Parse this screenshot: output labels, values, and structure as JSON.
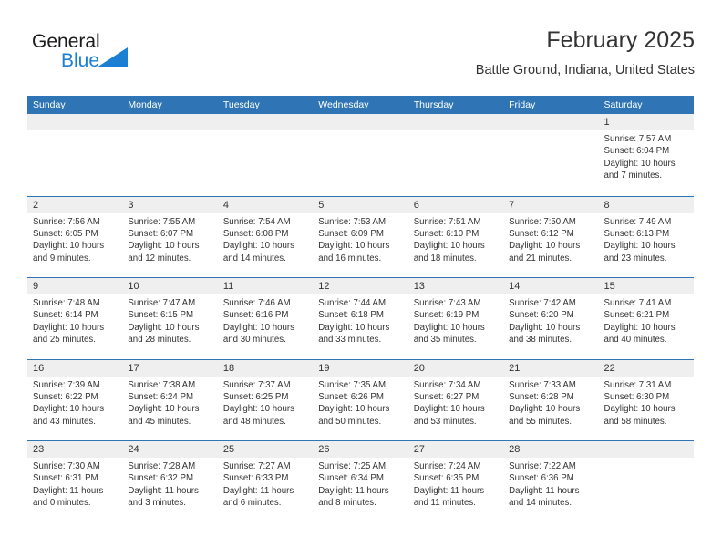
{
  "brand": {
    "name_part1": "General",
    "name_part2": "Blue",
    "triangle_color": "#1b7fd4",
    "text_color": "#1b1b1b"
  },
  "header": {
    "title": "February 2025",
    "subtitle": "Battle Ground, Indiana, United States"
  },
  "colors": {
    "header_blue": "#2f75b5",
    "daynum_band": "#efefef",
    "text": "#333333"
  },
  "weekdays": [
    "Sunday",
    "Monday",
    "Tuesday",
    "Wednesday",
    "Thursday",
    "Friday",
    "Saturday"
  ],
  "weeks": [
    [
      {
        "day": "",
        "sunrise": "",
        "sunset": "",
        "daylight": "",
        "empty": true
      },
      {
        "day": "",
        "sunrise": "",
        "sunset": "",
        "daylight": "",
        "empty": true
      },
      {
        "day": "",
        "sunrise": "",
        "sunset": "",
        "daylight": "",
        "empty": true
      },
      {
        "day": "",
        "sunrise": "",
        "sunset": "",
        "daylight": "",
        "empty": true
      },
      {
        "day": "",
        "sunrise": "",
        "sunset": "",
        "daylight": "",
        "empty": true
      },
      {
        "day": "",
        "sunrise": "",
        "sunset": "",
        "daylight": "",
        "empty": true
      },
      {
        "day": "1",
        "sunrise": "Sunrise: 7:57 AM",
        "sunset": "Sunset: 6:04 PM",
        "daylight": "Daylight: 10 hours and 7 minutes.",
        "empty": false
      }
    ],
    [
      {
        "day": "2",
        "sunrise": "Sunrise: 7:56 AM",
        "sunset": "Sunset: 6:05 PM",
        "daylight": "Daylight: 10 hours and 9 minutes.",
        "empty": false
      },
      {
        "day": "3",
        "sunrise": "Sunrise: 7:55 AM",
        "sunset": "Sunset: 6:07 PM",
        "daylight": "Daylight: 10 hours and 12 minutes.",
        "empty": false
      },
      {
        "day": "4",
        "sunrise": "Sunrise: 7:54 AM",
        "sunset": "Sunset: 6:08 PM",
        "daylight": "Daylight: 10 hours and 14 minutes.",
        "empty": false
      },
      {
        "day": "5",
        "sunrise": "Sunrise: 7:53 AM",
        "sunset": "Sunset: 6:09 PM",
        "daylight": "Daylight: 10 hours and 16 minutes.",
        "empty": false
      },
      {
        "day": "6",
        "sunrise": "Sunrise: 7:51 AM",
        "sunset": "Sunset: 6:10 PM",
        "daylight": "Daylight: 10 hours and 18 minutes.",
        "empty": false
      },
      {
        "day": "7",
        "sunrise": "Sunrise: 7:50 AM",
        "sunset": "Sunset: 6:12 PM",
        "daylight": "Daylight: 10 hours and 21 minutes.",
        "empty": false
      },
      {
        "day": "8",
        "sunrise": "Sunrise: 7:49 AM",
        "sunset": "Sunset: 6:13 PM",
        "daylight": "Daylight: 10 hours and 23 minutes.",
        "empty": false
      }
    ],
    [
      {
        "day": "9",
        "sunrise": "Sunrise: 7:48 AM",
        "sunset": "Sunset: 6:14 PM",
        "daylight": "Daylight: 10 hours and 25 minutes.",
        "empty": false
      },
      {
        "day": "10",
        "sunrise": "Sunrise: 7:47 AM",
        "sunset": "Sunset: 6:15 PM",
        "daylight": "Daylight: 10 hours and 28 minutes.",
        "empty": false
      },
      {
        "day": "11",
        "sunrise": "Sunrise: 7:46 AM",
        "sunset": "Sunset: 6:16 PM",
        "daylight": "Daylight: 10 hours and 30 minutes.",
        "empty": false
      },
      {
        "day": "12",
        "sunrise": "Sunrise: 7:44 AM",
        "sunset": "Sunset: 6:18 PM",
        "daylight": "Daylight: 10 hours and 33 minutes.",
        "empty": false
      },
      {
        "day": "13",
        "sunrise": "Sunrise: 7:43 AM",
        "sunset": "Sunset: 6:19 PM",
        "daylight": "Daylight: 10 hours and 35 minutes.",
        "empty": false
      },
      {
        "day": "14",
        "sunrise": "Sunrise: 7:42 AM",
        "sunset": "Sunset: 6:20 PM",
        "daylight": "Daylight: 10 hours and 38 minutes.",
        "empty": false
      },
      {
        "day": "15",
        "sunrise": "Sunrise: 7:41 AM",
        "sunset": "Sunset: 6:21 PM",
        "daylight": "Daylight: 10 hours and 40 minutes.",
        "empty": false
      }
    ],
    [
      {
        "day": "16",
        "sunrise": "Sunrise: 7:39 AM",
        "sunset": "Sunset: 6:22 PM",
        "daylight": "Daylight: 10 hours and 43 minutes.",
        "empty": false
      },
      {
        "day": "17",
        "sunrise": "Sunrise: 7:38 AM",
        "sunset": "Sunset: 6:24 PM",
        "daylight": "Daylight: 10 hours and 45 minutes.",
        "empty": false
      },
      {
        "day": "18",
        "sunrise": "Sunrise: 7:37 AM",
        "sunset": "Sunset: 6:25 PM",
        "daylight": "Daylight: 10 hours and 48 minutes.",
        "empty": false
      },
      {
        "day": "19",
        "sunrise": "Sunrise: 7:35 AM",
        "sunset": "Sunset: 6:26 PM",
        "daylight": "Daylight: 10 hours and 50 minutes.",
        "empty": false
      },
      {
        "day": "20",
        "sunrise": "Sunrise: 7:34 AM",
        "sunset": "Sunset: 6:27 PM",
        "daylight": "Daylight: 10 hours and 53 minutes.",
        "empty": false
      },
      {
        "day": "21",
        "sunrise": "Sunrise: 7:33 AM",
        "sunset": "Sunset: 6:28 PM",
        "daylight": "Daylight: 10 hours and 55 minutes.",
        "empty": false
      },
      {
        "day": "22",
        "sunrise": "Sunrise: 7:31 AM",
        "sunset": "Sunset: 6:30 PM",
        "daylight": "Daylight: 10 hours and 58 minutes.",
        "empty": false
      }
    ],
    [
      {
        "day": "23",
        "sunrise": "Sunrise: 7:30 AM",
        "sunset": "Sunset: 6:31 PM",
        "daylight": "Daylight: 11 hours and 0 minutes.",
        "empty": false
      },
      {
        "day": "24",
        "sunrise": "Sunrise: 7:28 AM",
        "sunset": "Sunset: 6:32 PM",
        "daylight": "Daylight: 11 hours and 3 minutes.",
        "empty": false
      },
      {
        "day": "25",
        "sunrise": "Sunrise: 7:27 AM",
        "sunset": "Sunset: 6:33 PM",
        "daylight": "Daylight: 11 hours and 6 minutes.",
        "empty": false
      },
      {
        "day": "26",
        "sunrise": "Sunrise: 7:25 AM",
        "sunset": "Sunset: 6:34 PM",
        "daylight": "Daylight: 11 hours and 8 minutes.",
        "empty": false
      },
      {
        "day": "27",
        "sunrise": "Sunrise: 7:24 AM",
        "sunset": "Sunset: 6:35 PM",
        "daylight": "Daylight: 11 hours and 11 minutes.",
        "empty": false
      },
      {
        "day": "28",
        "sunrise": "Sunrise: 7:22 AM",
        "sunset": "Sunset: 6:36 PM",
        "daylight": "Daylight: 11 hours and 14 minutes.",
        "empty": false
      },
      {
        "day": "",
        "sunrise": "",
        "sunset": "",
        "daylight": "",
        "empty": true
      }
    ]
  ]
}
